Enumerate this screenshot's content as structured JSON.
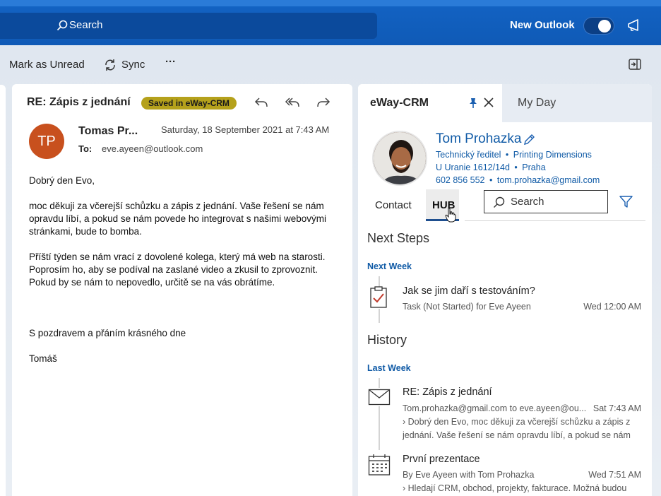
{
  "topbar": {
    "search_label": "Search",
    "new_outlook_label": "New Outlook",
    "new_outlook_on": true
  },
  "toolbar": {
    "mark_unread_label": "Mark as Unread",
    "sync_label": "Sync",
    "more_label": "···"
  },
  "email": {
    "subject": "RE: Zápis z jednání",
    "saved_badge": "Saved in eWay-CRM",
    "avatar_initials": "TP",
    "sender": "Tomas Pr...",
    "date": "Saturday, 18 September 2021 at 7:43 AM",
    "to_label": "To:",
    "to_address": "eve.ayeen@outlook.com",
    "body": [
      "Dobrý den Evo,",
      "moc děkuji za včerejší schůzku a zápis z jednání. Vaše řešení se nám opravdu líbí, a pokud se nám povede ho integrovat s našimi webovými stránkami, bude to bomba.",
      "Příští týden se nám vrací z dovolené kolega, který má web na starosti. Poprosím ho, aby se podíval na zaslané video a zkusil to zprovoznit. Pokud by se nám to nepovedlo, určitě se na vás obrátíme.",
      "",
      "S pozdravem a přáním krásného dne",
      "Tomáš"
    ]
  },
  "panel": {
    "tab_active": "eWay-CRM",
    "tab_other": "My Day",
    "contact": {
      "name": "Tom Prohazka",
      "title": "Technický ředitel",
      "company": "Printing Dimensions",
      "street": "U Uranie 1612/14d",
      "city": "Praha",
      "phone": "602 856 552",
      "email": "tom.prohazka@gmail.com",
      "sep": "•"
    },
    "subtabs": [
      "Contact",
      "HUB"
    ],
    "search_placeholder": "Search",
    "next_steps": {
      "heading": "Next Steps",
      "period": "Next Week",
      "items": [
        {
          "title": "Jak se jim daří s testováním?",
          "sub": "Task (Not Started) for Eve Ayeen",
          "time": "Wed 12:00 AM",
          "icon": "task-icon"
        }
      ]
    },
    "history": {
      "heading": "History",
      "period": "Last Week",
      "items": [
        {
          "title": "RE: Zápis z jednání",
          "sub": "Tom.prohazka@gmail.com to eve.ayeen@ou...",
          "time": "Sat 7:43 AM",
          "snippet": "› Dobrý den Evo,    moc děkuji za včerejší schůzku a zápis z jednání. Vaše řešení se nám opravdu líbí, a pokud se nám",
          "icon": "envelope-icon"
        },
        {
          "title": "První prezentace",
          "sub": "By Eve Ayeen with Tom Prohazka",
          "time": "Wed 7:51 AM",
          "snippet": "› Hledají CRM, obchod, projekty, fakturace. Možná budou",
          "icon": "calendar-icon"
        }
      ]
    }
  }
}
